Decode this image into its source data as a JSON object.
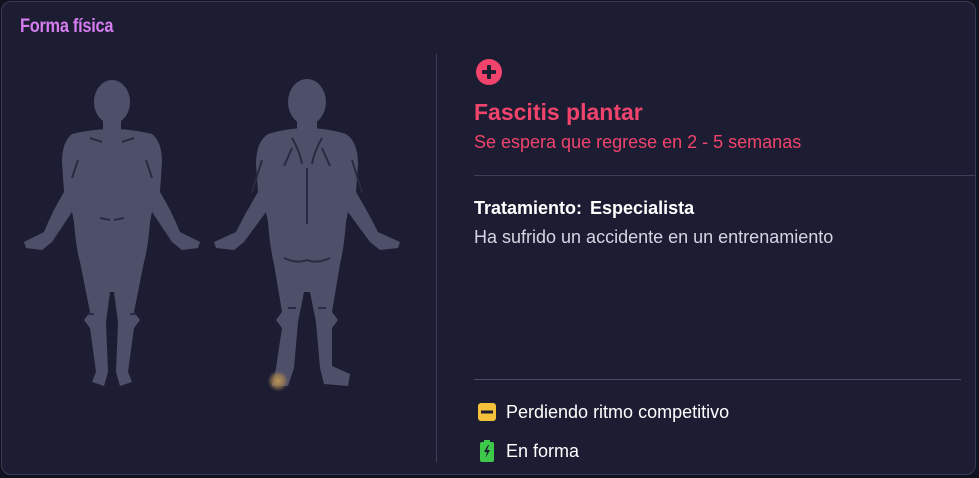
{
  "card": {
    "title": "Forma física"
  },
  "injury": {
    "name": "Fascitis plantar",
    "return_estimate": "Se espera que regrese en 2 - 5 semanas",
    "location": "right-heel",
    "icon": "plus-circle-icon"
  },
  "treatment": {
    "label": "Tratamiento:",
    "value": "Especialista",
    "description": "Ha sufrido un accidente en un entrenamiento"
  },
  "status": [
    {
      "icon": "minus-badge-icon",
      "label": "Perdiendo ritmo competitivo"
    },
    {
      "icon": "battery-charging-icon",
      "label": "En forma"
    }
  ],
  "colors": {
    "title": "#d77cf0",
    "injury": "#f0446c",
    "body": "#4e5069",
    "injury_spot": "#c49a55",
    "warning": "#f3c13a",
    "fit": "#3ec94a"
  }
}
